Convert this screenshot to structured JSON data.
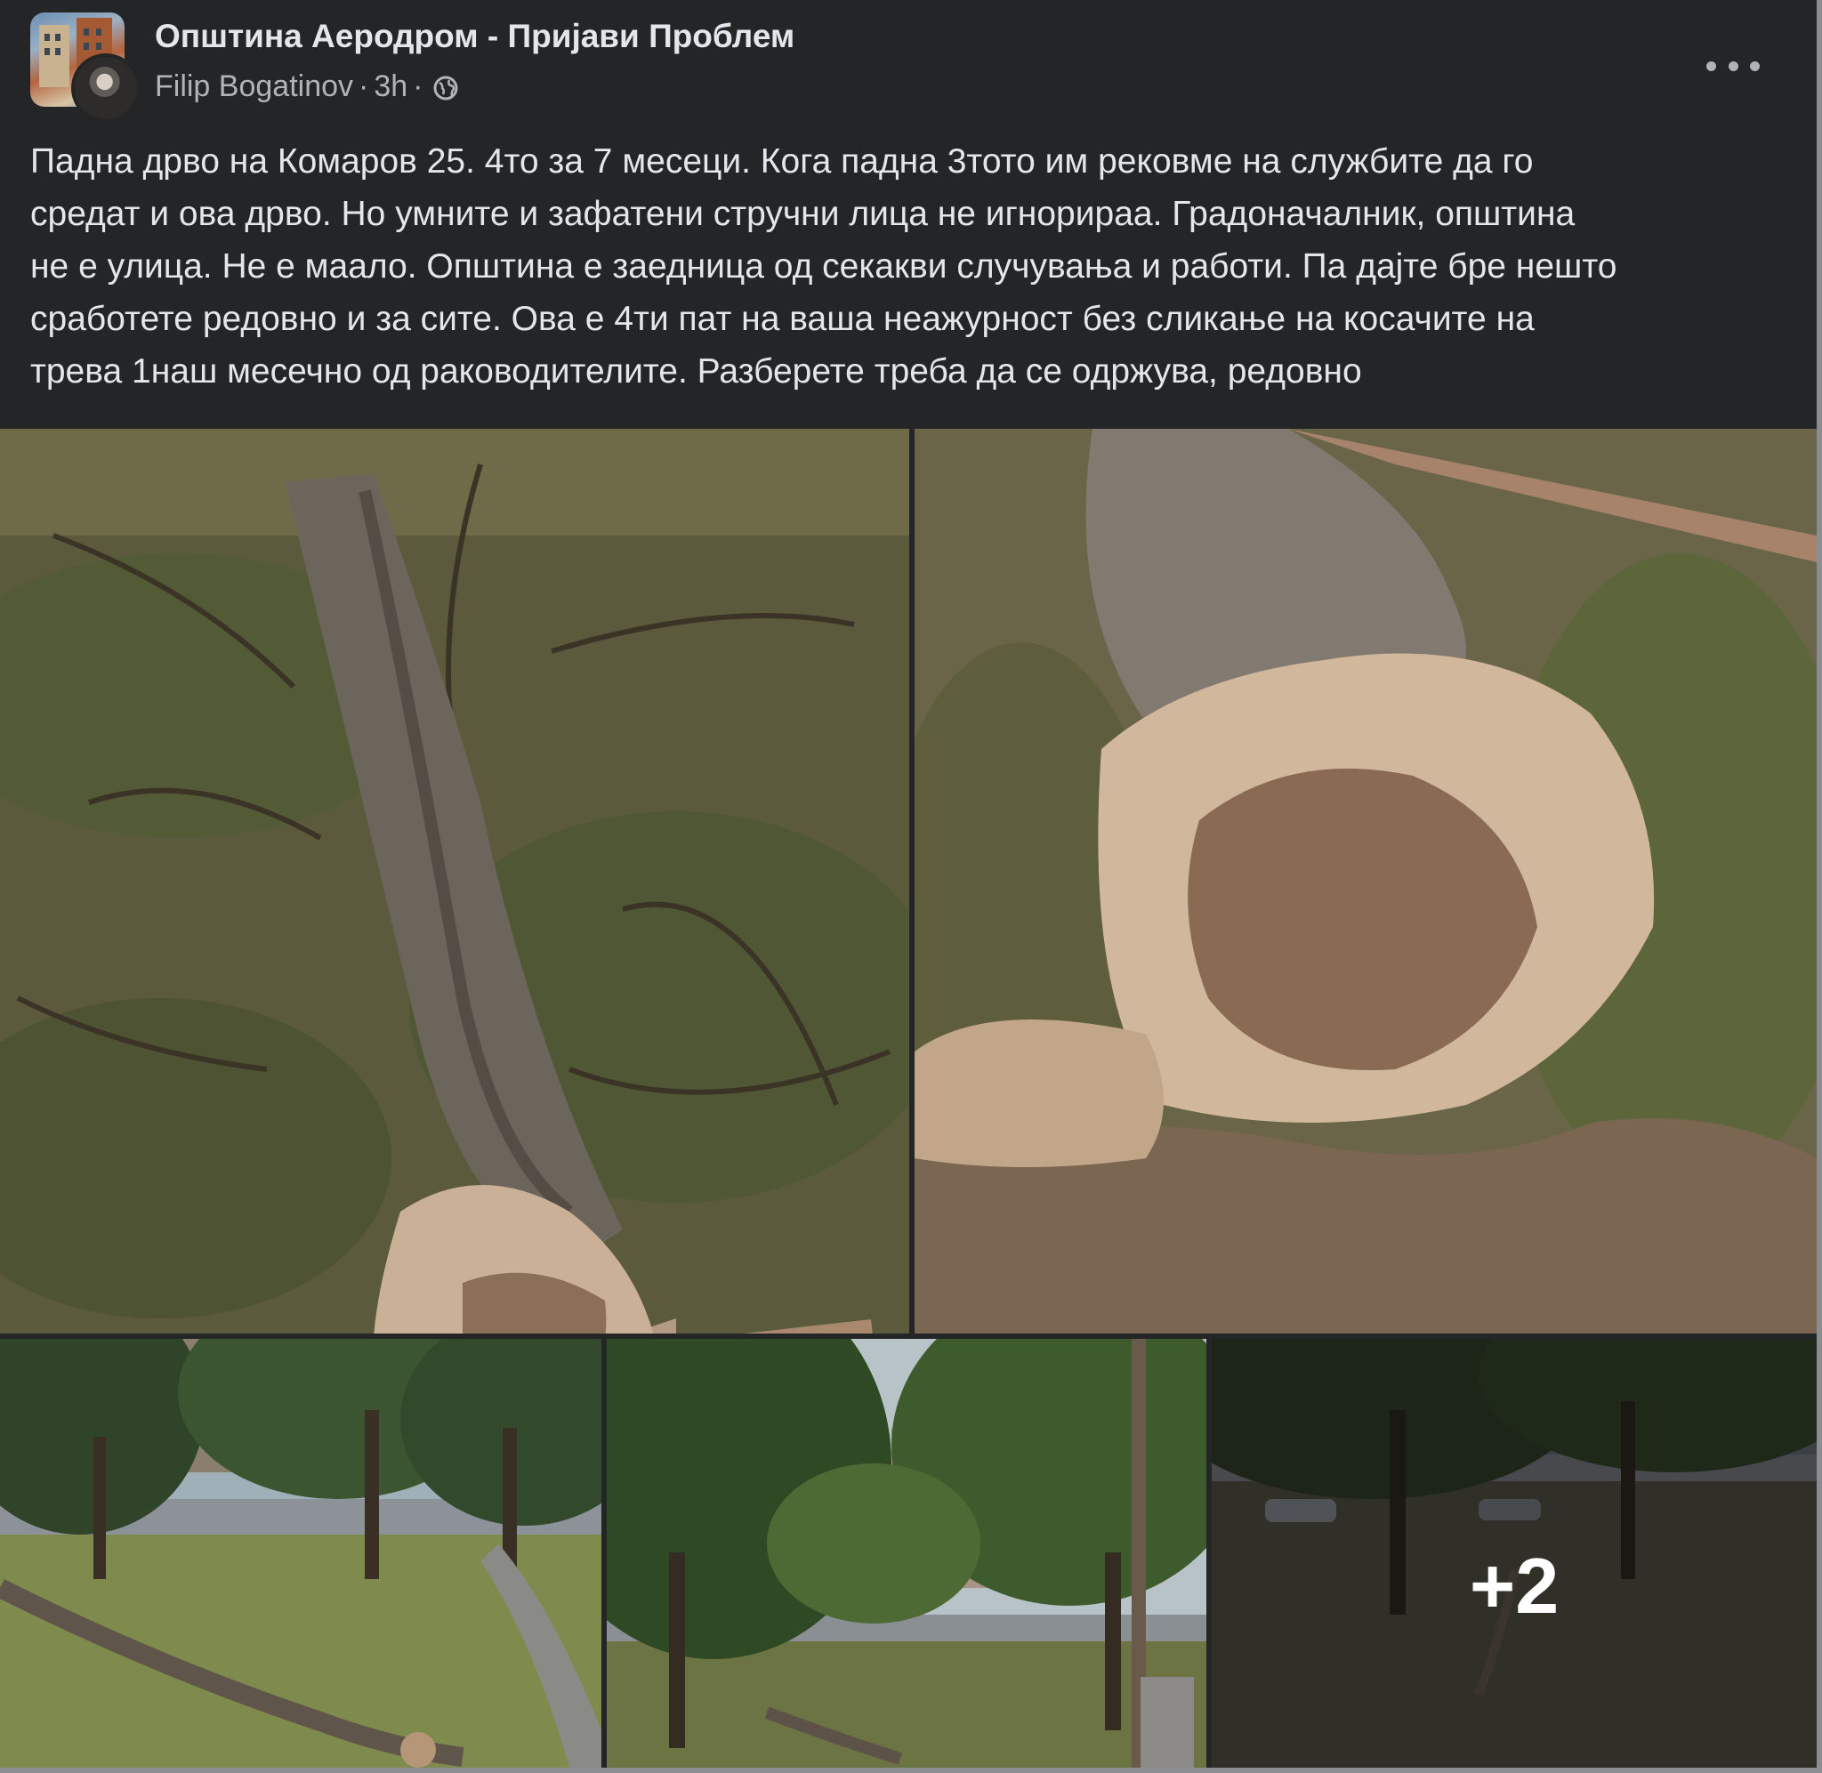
{
  "post": {
    "group_name": "Општина Аеродром - Пријави Проблем",
    "author": "Filip Bogatinov",
    "separator": "·",
    "time": "3h",
    "privacy_icon": "globe-icon",
    "more_icon": "more-options-icon",
    "text": "Падна дрво на Комаров 25. 4то за 7 месеци. Кога падна 3тото им рековме на службите да го\nсредат и ова дрво. Но умните и зафатени стручни лица не игнорираа. Градоначалник, општина\nне е улица. Не е маало. Општина е заедница од секакви случувања и работи. Па дајте бре нешто\nсработете редовно и за сите. Ова е 4ти пат на ваша неажурност без сликање на косачите на\nтрева 1наш месечно од раководителите. Разберете треба да се одржува, редовно"
  },
  "photos": {
    "remaining_count": "+2"
  },
  "colors": {
    "background": "#242526",
    "primary_text": "#e4e6eb",
    "secondary_text": "#b0b3b8"
  }
}
